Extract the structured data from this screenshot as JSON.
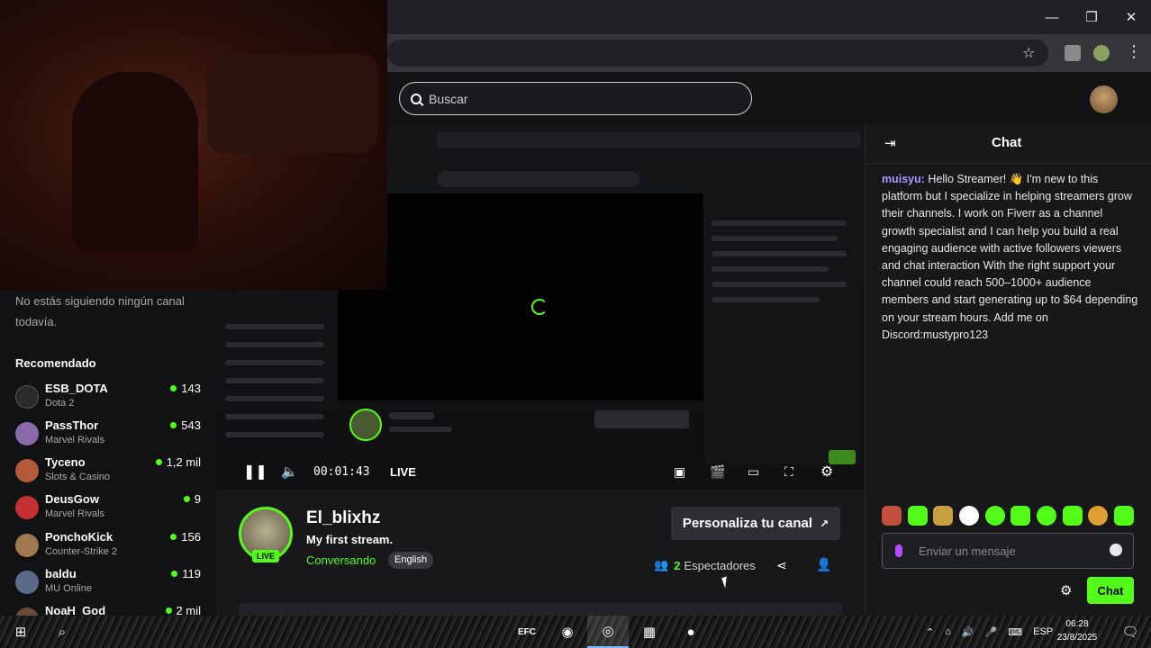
{
  "browser": {
    "window_controls": [
      "—",
      "❐",
      "✕"
    ]
  },
  "header": {
    "search_placeholder": "Buscar"
  },
  "sidebar": {
    "following_text": "No estás siguiendo ningún canal todavía.",
    "recommended_title": "Recomendado",
    "channels": [
      {
        "name": "ESB_DOTA",
        "game": "Dota 2",
        "viewers": "143",
        "color": "#2a2a2a"
      },
      {
        "name": "PassThor",
        "game": "Marvel Rivals",
        "viewers": "543",
        "color": "#8a6aa8"
      },
      {
        "name": "Tyceno",
        "game": "Slots & Casino",
        "viewers": "1,2 mil",
        "color": "#b35a3a"
      },
      {
        "name": "DeusGow",
        "game": "Marvel Rivals",
        "viewers": "9",
        "color": "#c43030"
      },
      {
        "name": "PonchoKick",
        "game": "Counter-Strike 2",
        "viewers": "156",
        "color": "#a07850"
      },
      {
        "name": "baldu",
        "game": "MU Online",
        "viewers": "119",
        "color": "#5a6a8a"
      },
      {
        "name": "NoaH_God",
        "game": "",
        "viewers": "2 mil",
        "color": "#6a4a3a"
      }
    ]
  },
  "player": {
    "time": "00:01:43",
    "live_label": "LIVE"
  },
  "channel": {
    "name": "El_blixhz",
    "title": "My first stream.",
    "category": "Conversando",
    "language": "English",
    "live_badge": "LIVE",
    "customize_label": "Personaliza tu canal",
    "viewers_count": "2",
    "viewers_label": "Espectadores"
  },
  "chat": {
    "title": "Chat",
    "message_user": "muisyu:",
    "message_text": "Hello Streamer! 👋 I'm new to this platform but I specialize in helping streamers grow their channels. I work on Fiverr as a channel growth specialist and I can help you build a real engaging audience with active followers viewers and chat interaction With the right support your channel could reach 500–1000+ audience members and start generating up to $64 depending on your stream hours. Add me on Discord:mustypro123",
    "input_placeholder": "Enviar un mensaje",
    "send_label": "Chat",
    "emote_colors": [
      "#c0503a",
      "#53fc18",
      "#c8a040",
      "#ffffff",
      "#53fc18",
      "#53fc18",
      "#53fc18",
      "#53fc18",
      "#e0a030",
      "#53fc18"
    ]
  },
  "taskbar": {
    "language": "ESP",
    "time": "06:28",
    "date": "23/8/2025"
  },
  "colors": {
    "accent": "#53fc18",
    "chat_user": "#a59bff"
  }
}
